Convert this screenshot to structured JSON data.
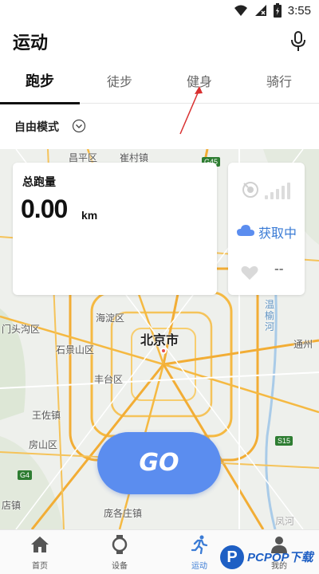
{
  "status_bar": {
    "time": "3:55",
    "icons": [
      "wifi-icon",
      "signal-icon",
      "battery-charging-icon"
    ]
  },
  "header": {
    "title": "运动",
    "mic_icon": "microphone-icon"
  },
  "tabs": [
    {
      "label": "跑步",
      "active": true
    },
    {
      "label": "徒步",
      "active": false
    },
    {
      "label": "健身",
      "active": false
    },
    {
      "label": "骑行",
      "active": false
    }
  ],
  "mode": {
    "label": "自由模式",
    "icon": "chevron-down-circle-icon"
  },
  "map": {
    "city": "北京市",
    "labels": [
      "昌平区",
      "崔村镇",
      "海淀区",
      "门头沟区",
      "石景山区",
      "丰台区",
      "王佐镇",
      "房山区",
      "庞各庄镇",
      "店镇",
      "温榆河",
      "通州",
      "凤河"
    ],
    "road_badges": [
      "G45",
      "S15",
      "G4"
    ]
  },
  "distance_card": {
    "title": "总跑量",
    "value": "0.00",
    "unit": "km"
  },
  "info_card": {
    "gps_icon": "gps-satellite-icon",
    "weather_icon": "cloud-icon",
    "weather_text": "获取中",
    "heart_icon": "heart-icon",
    "heart_rate": "--"
  },
  "go_button": {
    "label": "GO"
  },
  "bottom_nav": [
    {
      "label": "首页",
      "icon": "home-icon",
      "active": false
    },
    {
      "label": "设备",
      "icon": "watch-icon",
      "active": false
    },
    {
      "label": "运动",
      "icon": "running-icon",
      "active": true
    },
    {
      "label": "我的",
      "icon": "profile-icon",
      "active": false
    }
  ],
  "watermark": {
    "logo": "P",
    "text": "PCPOP下载"
  },
  "colors": {
    "accent": "#5b8def",
    "active_blue": "#3a7bd5",
    "road_yellow": "#f5b942",
    "annotation_red": "#d93030"
  }
}
